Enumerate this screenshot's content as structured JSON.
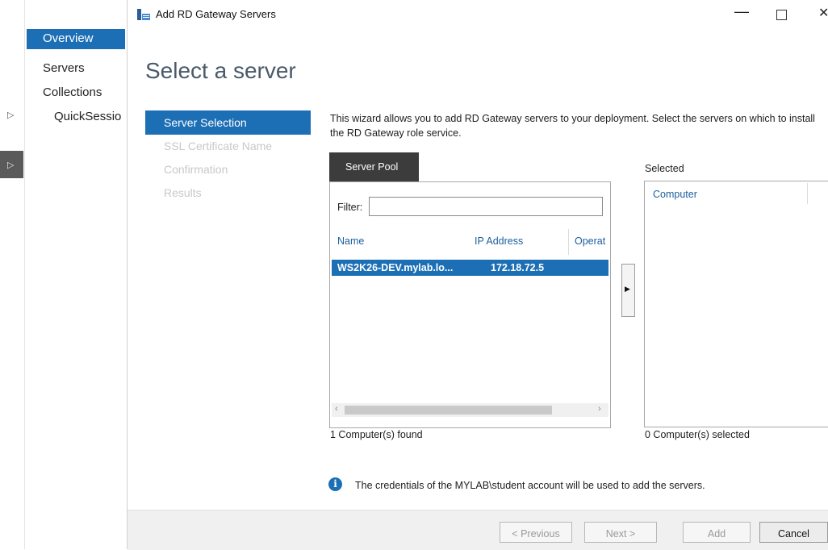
{
  "window": {
    "title": "Add RD Gateway Servers",
    "icon": "server-wizard-icon",
    "controls": {
      "minimize": "—",
      "close": "✕"
    }
  },
  "background_nav": {
    "items": [
      "Overview",
      "Servers",
      "Collections",
      "QuickSessio"
    ]
  },
  "wizard": {
    "heading": "Select a server",
    "steps": [
      "Server Selection",
      "SSL Certificate Name",
      "Confirmation",
      "Results"
    ],
    "description": "This wizard allows you to add RD Gateway servers to your deployment. Select the servers on which to install the RD Gateway role service.",
    "server_pool": {
      "tab_label": "Server Pool",
      "filter_label": "Filter:",
      "filter_value": "",
      "columns": [
        "Name",
        "IP Address",
        "Operat"
      ],
      "rows": [
        {
          "name": "WS2K26-DEV.mylab.lo...",
          "ip": "172.18.72.5"
        }
      ],
      "found_text": "1 Computer(s) found"
    },
    "selected": {
      "label": "Selected",
      "column": "Computer",
      "count_text": "0 Computer(s) selected"
    },
    "info_text": "The credentials of the MYLAB\\student account will be used to add the servers.",
    "buttons": {
      "previous": "< Previous",
      "next": "Next >",
      "add": "Add",
      "cancel": "Cancel"
    }
  },
  "colors": {
    "accent": "#1c6fb5",
    "tab_dark": "#3c3c3c",
    "disabled_text": "#c8c8c8"
  }
}
